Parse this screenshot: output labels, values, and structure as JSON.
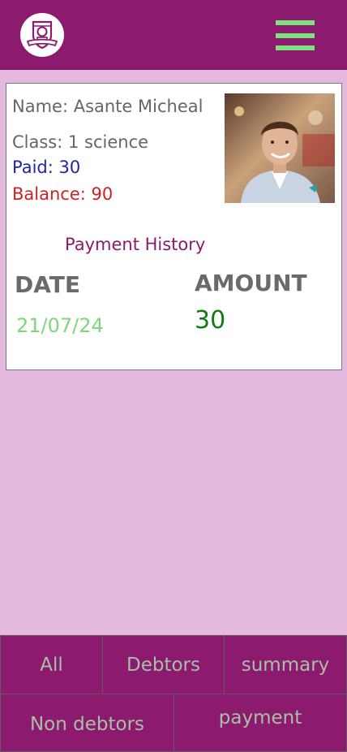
{
  "header": {
    "logo_icon": "school-crest-icon",
    "menu_icon": "hamburger-menu-icon",
    "accent_color": "#7be37b",
    "bar_color": "#8c1a6e"
  },
  "student": {
    "name": "Name: Asante Micheal",
    "class": "Class: 1 science",
    "paid": "Paid: 30",
    "balance": "Balance: 90",
    "photo_icon": "student-photo"
  },
  "history": {
    "title": "Payment History",
    "col_date": "DATE",
    "col_amount": "AMOUNT",
    "rows": [
      {
        "date": "21/07/24",
        "amount": "30"
      }
    ]
  },
  "bottom_nav": {
    "all": "All",
    "debtors": "Debtors",
    "summary": "summary",
    "non_debtors": "Non debtors",
    "payment": "payment"
  }
}
